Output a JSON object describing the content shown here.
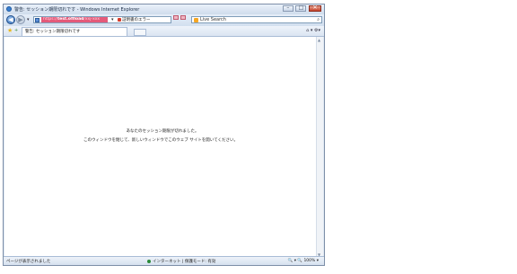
{
  "window": {
    "title": "警告: セッション期限切れです - Windows Internet Explorer",
    "controls": {
      "minimize": "–",
      "maximize": "□",
      "close": "✕"
    }
  },
  "nav": {
    "back_glyph": "◀",
    "forward_glyph": "▶",
    "dropdown_glyph": "▾",
    "address": {
      "prefix": "https://",
      "host": "test.offload",
      "path_hint": "/xxj-xxx",
      "dropdown_glyph": "▾",
      "cert_error_label": "証明書のエラー"
    },
    "search": {
      "placeholder": "Live Search",
      "glass_glyph": "⌕"
    }
  },
  "tabs": {
    "active_tab_label": "警告: セッション期限切れです",
    "favorites_glyph": "★",
    "add_fav_glyph": "+",
    "tools_glyphs": "⌂ ▾ ⚙▾"
  },
  "content": {
    "line1": "あなたのセッション期限が切れました。",
    "line2": "このウィンドウを閉じて、新しいウィンドウでこのウェブ サイトを開いてください。"
  },
  "status": {
    "left_text": "ページが表示されました",
    "zone_text": "インターネット | 保護モード: 有効",
    "zoom_text": "🔍 ▾  🔍 100%  ▾"
  },
  "colors": {
    "address_url_highlight": "#e45a7a",
    "cert_error": "#d63a2a",
    "window_frame": "#7d8fa8"
  }
}
